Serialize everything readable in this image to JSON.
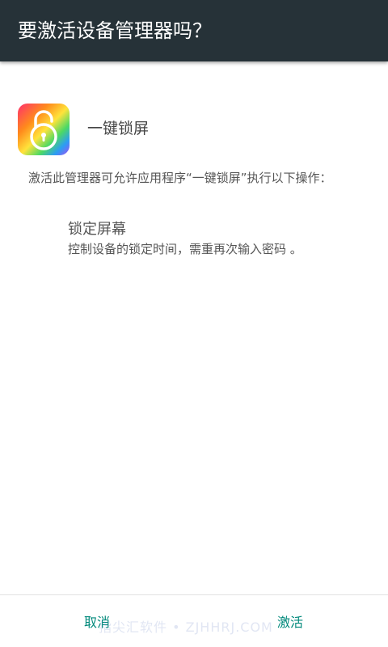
{
  "dialog": {
    "title": "要激活设备管理器吗？",
    "app_icon": "unlock-padlock-icon",
    "app_name": "一键锁屏",
    "description": "激活此管理器可允许应用程序“一键锁屏”执行以下操作：",
    "policy": {
      "title": "锁定屏幕",
      "description": "控制设备的锁定时间，需重再次输入密码 。"
    }
  },
  "buttons": {
    "cancel": "取消",
    "activate": "激活"
  },
  "watermark": "指尖汇软件 • ZJHHRJ.COM",
  "colors": {
    "title_bar": "#263238",
    "button_text": "#00897b"
  }
}
